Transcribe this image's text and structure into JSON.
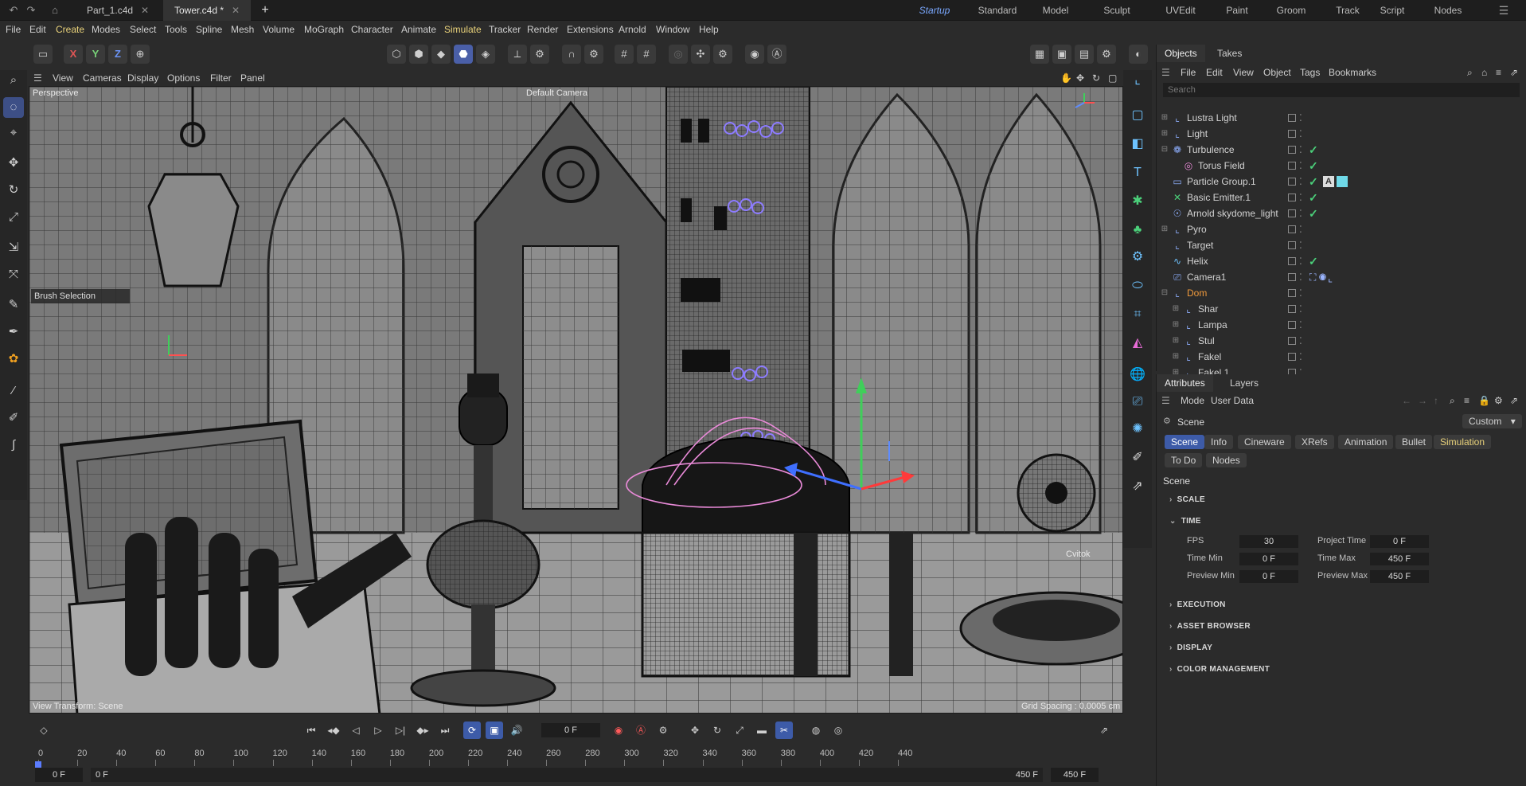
{
  "tabs": {
    "docs": [
      {
        "label": "Part_1.c4d",
        "active": false
      },
      {
        "label": "Tower.c4d *",
        "active": true
      }
    ],
    "add_label": "+",
    "layouts": [
      "Startup",
      "Standard",
      "Model",
      "Sculpt",
      "UVEdit",
      "Paint",
      "Groom",
      "Track",
      "Script",
      "Nodes"
    ],
    "active_layout": "Startup"
  },
  "menubar": [
    "File",
    "Edit",
    "Create",
    "Modes",
    "Select",
    "Tools",
    "Spline",
    "Mesh",
    "Volume",
    "MoGraph",
    "Character",
    "Animate",
    "Simulate",
    "Tracker",
    "Render",
    "Extensions",
    "Arnold",
    "Window",
    "Help"
  ],
  "toolbar": {
    "x": "X",
    "y": "Y",
    "z": "Z"
  },
  "viewport": {
    "menu": [
      "View",
      "Cameras",
      "Display",
      "Options",
      "Filter",
      "Panel"
    ],
    "perspective_label": "Perspective",
    "camera_label": "Default Camera",
    "brush_selection": "Brush Selection",
    "transform_label": "View Transform: Scene",
    "grid_spacing": "Grid Spacing : 0.0005 cm",
    "object_label": "Cvitok"
  },
  "objects": {
    "tabs": [
      "Objects",
      "Takes"
    ],
    "menu": [
      "File",
      "Edit",
      "View",
      "Object",
      "Tags",
      "Bookmarks"
    ],
    "search_placeholder": "Search",
    "rows": [
      {
        "name": "Lustra Light",
        "icon": "null-icon",
        "expand": "+",
        "indent": 0,
        "check": false
      },
      {
        "name": "Light",
        "icon": "null-icon",
        "expand": "+",
        "indent": 0,
        "check": false
      },
      {
        "name": "Turbulence",
        "icon": "turbulence-icon",
        "expand": "-",
        "indent": 0,
        "check": true
      },
      {
        "name": "Torus Field",
        "icon": "torus-field-icon",
        "expand": "",
        "indent": 1,
        "check": true
      },
      {
        "name": "Particle Group.1",
        "icon": "folder-icon",
        "expand": "",
        "indent": 0,
        "check": true,
        "tags": true
      },
      {
        "name": "Basic Emitter.1",
        "icon": "emitter-icon",
        "expand": "",
        "indent": 0,
        "check": true
      },
      {
        "name": "Arnold skydome_light",
        "icon": "light-icon",
        "expand": "",
        "indent": 0,
        "check": true
      },
      {
        "name": "Pyro",
        "icon": "null-icon",
        "expand": "+",
        "indent": 0,
        "check": false
      },
      {
        "name": "Target",
        "icon": "null-icon",
        "expand": "",
        "indent": 0,
        "check": false
      },
      {
        "name": "Helix",
        "icon": "helix-icon",
        "expand": "",
        "indent": 0,
        "check": true
      },
      {
        "name": "Camera1",
        "icon": "camera-icon",
        "expand": "",
        "indent": 0,
        "check": false,
        "camtags": true
      },
      {
        "name": "Dom",
        "icon": "null-icon",
        "expand": "-",
        "indent": 0,
        "check": false,
        "orange": true
      },
      {
        "name": "Shar",
        "icon": "null-icon",
        "expand": "+",
        "indent": 1,
        "check": false
      },
      {
        "name": "Lampa",
        "icon": "null-icon",
        "expand": "+",
        "indent": 1,
        "check": false
      },
      {
        "name": "Stul",
        "icon": "null-icon",
        "expand": "+",
        "indent": 1,
        "check": false
      },
      {
        "name": "Fakel",
        "icon": "null-icon",
        "expand": "+",
        "indent": 1,
        "check": false
      },
      {
        "name": "Fakel.1",
        "icon": "null-icon",
        "expand": "+",
        "indent": 1,
        "check": false
      }
    ]
  },
  "attributes": {
    "tabs": [
      "Attributes",
      "Layers"
    ],
    "menu": [
      "Mode",
      "User Data"
    ],
    "scene_label": "Scene",
    "preset": "Custom",
    "buttons_row1": [
      "Scene",
      "Info",
      "Cineware",
      "XRefs",
      "Animation",
      "Bullet",
      "Simulation"
    ],
    "buttons_row2": [
      "To Do",
      "Nodes"
    ],
    "heading": "Scene",
    "sections": [
      "SCALE",
      "TIME",
      "EXECUTION",
      "ASSET BROWSER",
      "DISPLAY",
      "COLOR MANAGEMENT"
    ],
    "time": {
      "fps_label": "FPS",
      "fps": "30",
      "project_time_label": "Project Time",
      "project_time": "0 F",
      "time_min_label": "Time Min",
      "time_min": "0 F",
      "time_max_label": "Time Max",
      "time_max": "450 F",
      "preview_min_label": "Preview Min",
      "preview_min": "0 F",
      "preview_max_label": "Preview Max",
      "preview_max": "450 F"
    }
  },
  "timeline": {
    "current_frame": "0 F",
    "ticks": [
      "0",
      "20",
      "40",
      "60",
      "80",
      "100",
      "120",
      "140",
      "160",
      "180",
      "200",
      "220",
      "240",
      "260",
      "280",
      "300",
      "320",
      "340",
      "360",
      "380",
      "400",
      "420",
      "440"
    ],
    "start": "0 F",
    "preview_start": "0 F",
    "preview_end": "450 F",
    "end": "450 F"
  },
  "colors": {
    "accent": "#4a5fa8",
    "check": "#4bd07a",
    "orange": "#f09a3c",
    "layout_active": "#7aa8ff"
  }
}
